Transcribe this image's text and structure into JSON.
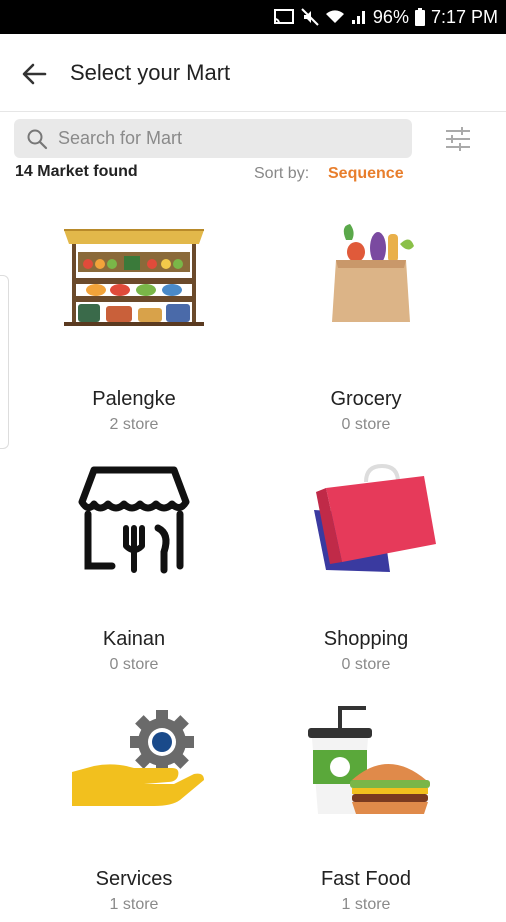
{
  "status_bar": {
    "battery": "96%",
    "time": "7:17 PM"
  },
  "header": {
    "title": "Select your Mart"
  },
  "search": {
    "placeholder": "Search for Mart"
  },
  "results": {
    "count_text": "14 Market found",
    "sort_label": "Sort by:",
    "sort_value": "Sequence"
  },
  "colors": {
    "accent": "#e87e2c"
  },
  "markets": [
    {
      "name": "Palengke",
      "stores": "2 store",
      "icon": "market-stall-icon"
    },
    {
      "name": "Grocery",
      "stores": "0 store",
      "icon": "grocery-bag-icon"
    },
    {
      "name": "Kainan",
      "stores": "0 store",
      "icon": "restaurant-icon"
    },
    {
      "name": "Shopping",
      "stores": "0 store",
      "icon": "sale-shopping-bags-icon"
    },
    {
      "name": "Services",
      "stores": "1 store",
      "icon": "services-gear-hand-icon"
    },
    {
      "name": "Fast Food",
      "stores": "1 store",
      "icon": "burger-drink-icon"
    }
  ]
}
